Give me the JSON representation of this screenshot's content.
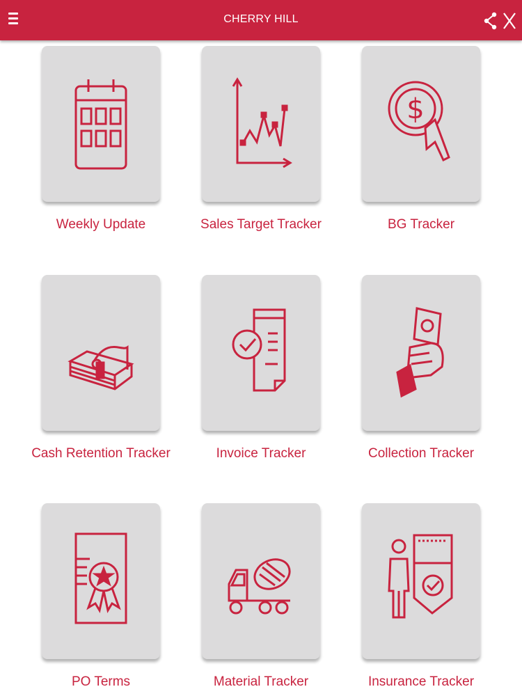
{
  "header": {
    "title": "CHERRY HILL",
    "menu_icon": "hamburger-menu-icon",
    "share_icon": "share-icon",
    "close_icon": "close-icon",
    "bar_color": "#c8233f"
  },
  "tiles": [
    {
      "label": "Weekly Update",
      "icon": "calendar-icon"
    },
    {
      "label": "Sales Target Tracker",
      "icon": "line-chart-icon"
    },
    {
      "label": "BG Tracker",
      "icon": "dollar-coin-cursor-icon"
    },
    {
      "label": "Cash Retention Tracker",
      "icon": "cash-stack-icon"
    },
    {
      "label": "Invoice Tracker",
      "icon": "invoice-check-icon"
    },
    {
      "label": "Collection Tracker",
      "icon": "hand-money-icon"
    },
    {
      "label": "PO Terms",
      "icon": "certificate-badge-icon"
    },
    {
      "label": "Material Tracker",
      "icon": "concrete-mixer-truck-icon"
    },
    {
      "label": "Insurance Tracker",
      "icon": "insurance-shield-icon"
    }
  ],
  "theme": {
    "accent": "#c8233f",
    "tile_bg": "#dcdbdc"
  }
}
